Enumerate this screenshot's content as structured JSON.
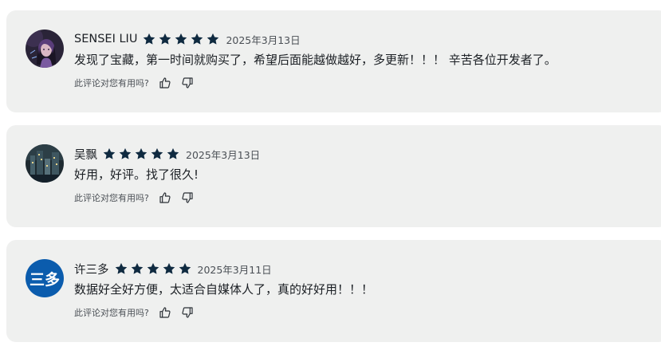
{
  "reviews": [
    {
      "name": "SENSEI LIU",
      "rating": 5,
      "date": "2025年3月13日",
      "text": "发现了宝藏，第一时间就购买了，希望后面能越做越好，多更新！！！ 辛苦各位开发者了。",
      "helpful_prompt": "此评论对您有用吗?",
      "avatar_icon": "user-photo-anime-girl"
    },
    {
      "name": "吴飘",
      "rating": 5,
      "date": "2025年3月13日",
      "text": "好用，好评。找了很久!",
      "helpful_prompt": "此评论对您有用吗?",
      "avatar_icon": "user-photo-city-night"
    },
    {
      "name": "许三多",
      "rating": 5,
      "date": "2025年3月11日",
      "text": "数据好全好方便，太适合自媒体人了，真的好好用！！！",
      "helpful_prompt": "此评论对您有用吗?",
      "avatar_text": "三多",
      "avatar_color": "#0b5cad"
    }
  ],
  "colors": {
    "card_background": "#eff0ef",
    "star": "#0f2a40"
  },
  "icons": {
    "star": "star-icon",
    "thumbs_up": "thumbs-up-icon",
    "thumbs_down": "thumbs-down-icon"
  }
}
